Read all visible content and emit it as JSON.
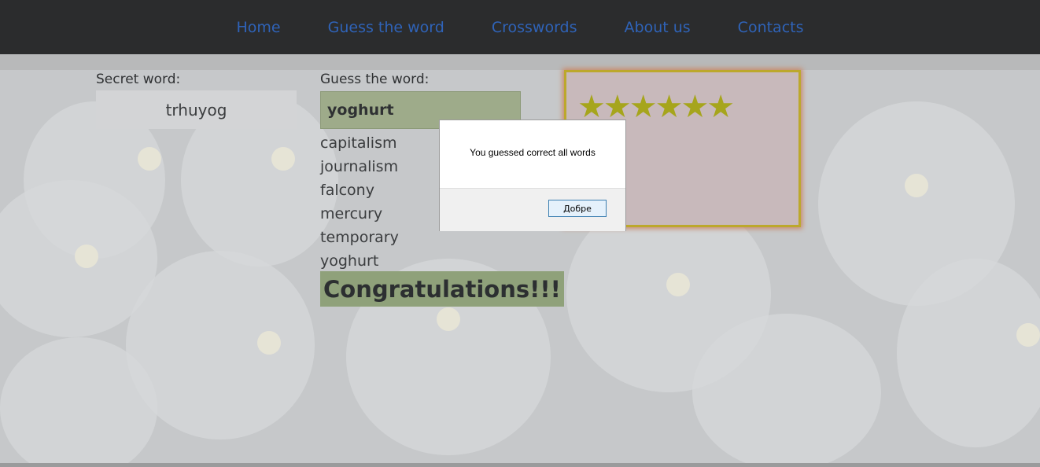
{
  "nav": {
    "items": [
      {
        "label": "Home"
      },
      {
        "label": "Guess the word"
      },
      {
        "label": "Crosswords"
      },
      {
        "label": "About us"
      },
      {
        "label": "Contacts"
      }
    ]
  },
  "secret": {
    "label": "Secret word:",
    "value": "trhuyog"
  },
  "guess": {
    "label": "Guess the word:",
    "value": "yoghurt"
  },
  "words": [
    "capitalism",
    "journalism",
    "falcony",
    "mercury",
    "temporary",
    "yoghurt"
  ],
  "congrats": "Congratulations!!!",
  "rating": {
    "stars": 6,
    "star_icon": "star-icon",
    "star_color": "#a6a51c"
  },
  "dialog": {
    "message": "You guessed correct all words",
    "ok_label": "Добре"
  },
  "colors": {
    "nav_bg": "#2b2c2d",
    "nav_link": "#2f63b8",
    "input_bg": "#9eab8a",
    "congrats_bg": "#8fa17a",
    "rating_border": "#bca82c"
  }
}
